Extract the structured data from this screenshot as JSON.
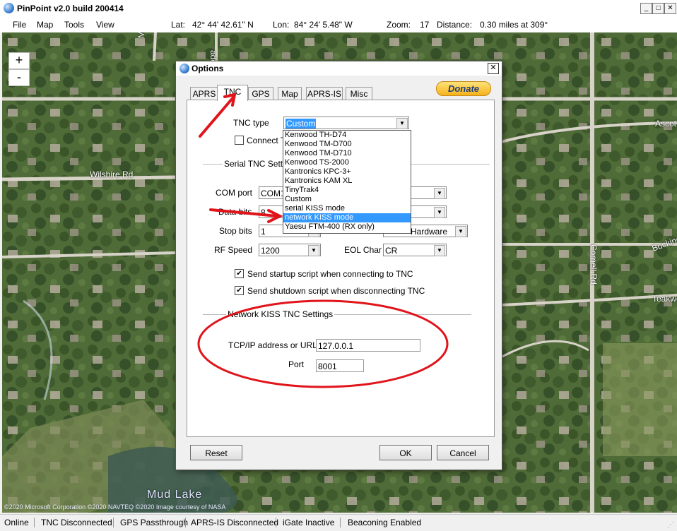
{
  "window": {
    "title": "PinPoint v2.0 build 200414",
    "min": "_",
    "max": "□",
    "close": "✕"
  },
  "menu": [
    "File",
    "Map",
    "Tools",
    "View"
  ],
  "coords": {
    "lat_label": "Lat:",
    "lat_value": "42° 44' 42.61\" N",
    "lon_label": "Lon:",
    "lon_value": "84° 24' 5.48\" W",
    "zoom_label": "Zoom:",
    "zoom_value": "17",
    "distance_label": "Distance:",
    "distance_value": "0.30 miles at 309°"
  },
  "map": {
    "zoom_in": "+",
    "zoom_out": "-",
    "labels": [
      "Monterey Ave",
      "ade St",
      "Wilshire Rd",
      "Mud Lake",
      "Cornell Rd",
      "Ascot",
      "Buckingham",
      "Teakwood"
    ],
    "credit": "©2020 Microsoft Corporation  ©2020 NAVTEQ  ©2020 Image courtesy of NASA"
  },
  "status": [
    "Online",
    "TNC Disconnected",
    "GPS Passthrough",
    "APRS-IS Disconnected",
    "iGate Inactive",
    "Beaconing Enabled"
  ],
  "dialog": {
    "title": "Options",
    "close": "✕",
    "tabs": [
      "APRS",
      "TNC",
      "GPS",
      "Map",
      "APRS-IS",
      "Misc"
    ],
    "donate": "Donate",
    "tnc_type_label": "TNC type",
    "tnc_type_value": "Custom",
    "connect_label": "Connect T",
    "serial_group": "Serial TNC Setting",
    "com_port_label": "COM port",
    "com_port_value": "COM1",
    "data_bits_label": "Data bits",
    "data_bits_value": "8",
    "stop_bits_label": "Stop bits",
    "stop_bits_value": "1",
    "rf_speed_label": "RF Speed",
    "rf_speed_value": "1200",
    "eol_label": "EOL Char",
    "eol_value": "CR",
    "flow_value": "Hardware",
    "startup_script": "Send startup script when connecting to TNC",
    "shutdown_script": "Send shutdown script when disconnecting TNC",
    "network_group": "Network KISS TNC Settings",
    "tcp_label": "TCP/IP address or URL",
    "tcp_value": "127.0.0.1",
    "port_label": "Port",
    "port_value": "8001",
    "reset": "Reset",
    "ok": "OK",
    "cancel": "Cancel",
    "dropdown_items": [
      "Kenwood TH-D74",
      "Kenwood TM-D700",
      "Kenwood TM-D710",
      "Kenwood TS-2000",
      "Kantronics KPC-3+",
      "Kantronics KAM XL",
      "TinyTrak4",
      "Custom",
      "serial KISS mode",
      "network KISS mode",
      "Yaesu FTM-400 (RX only)"
    ],
    "dropdown_selected": 9
  },
  "colors": {
    "annotation": "#e0141a",
    "selection": "#3399ff",
    "donate": "#f6b21b"
  }
}
